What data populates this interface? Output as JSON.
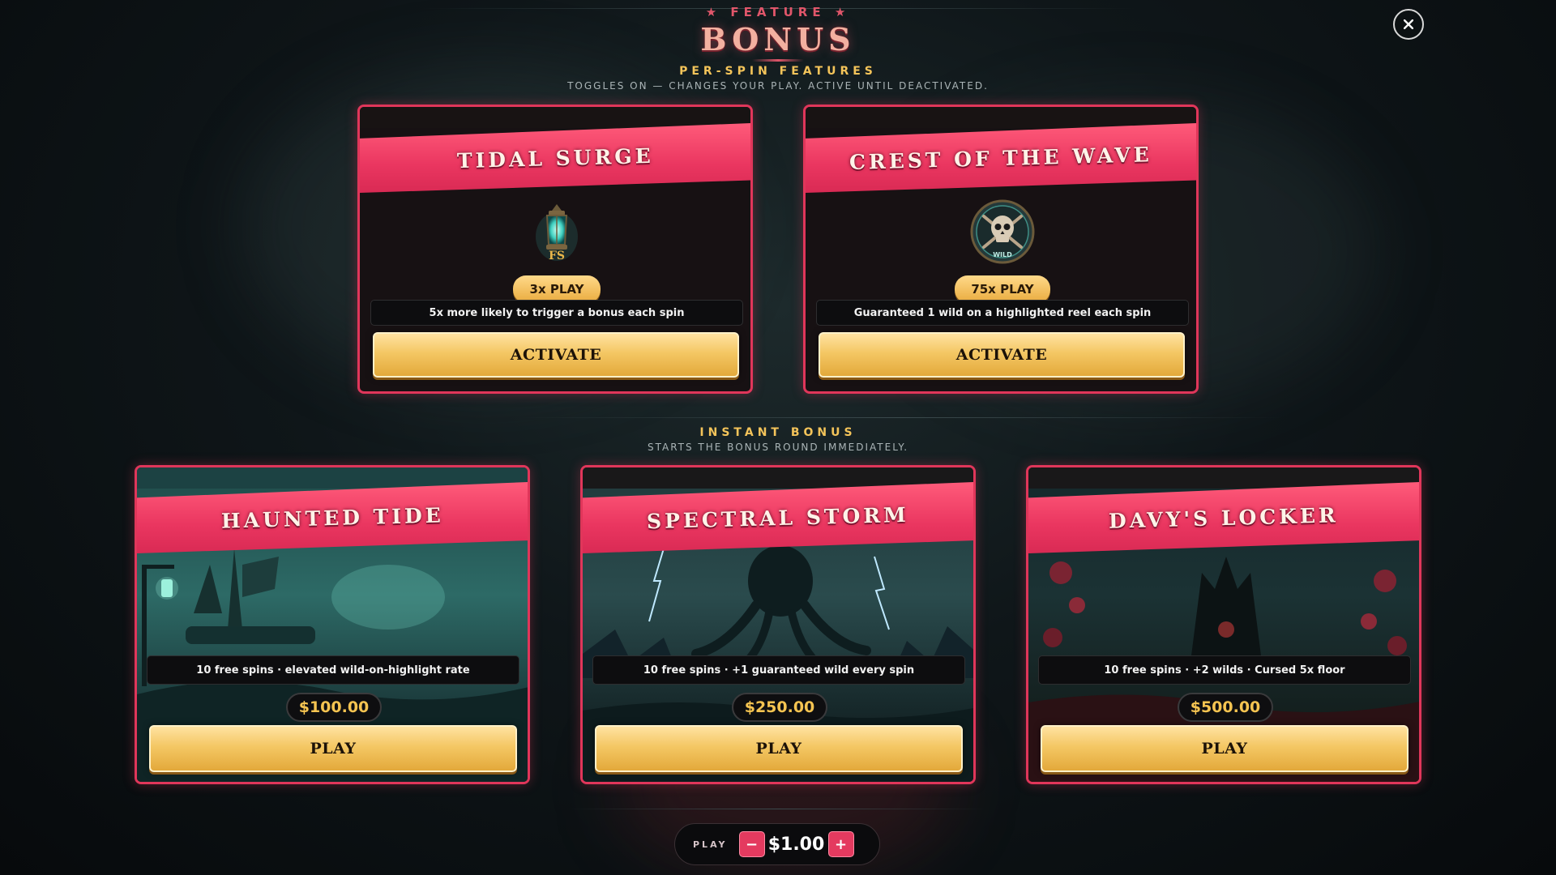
{
  "header": {
    "kicker": "FEATURE",
    "title": "BONUS"
  },
  "close_symbol": "close-icon",
  "per_spin": {
    "title": "PER-SPIN FEATURES",
    "subtitle": "TOGGLES ON — CHANGES YOUR PLAY. ACTIVE UNTIL DEACTIVATED.",
    "cards": [
      {
        "name": "TIDAL SURGE",
        "icon": "lantern-fs-icon",
        "cost": "3x PLAY",
        "description": "5x more likely to trigger a bonus each spin",
        "button": "ACTIVATE"
      },
      {
        "name": "CREST OF THE WAVE",
        "icon": "skull-wild-icon",
        "cost": "75x PLAY",
        "description": "Guaranteed 1 wild on a highlighted reel each spin",
        "button": "ACTIVATE"
      }
    ]
  },
  "instant": {
    "title": "INSTANT BONUS",
    "subtitle": "STARTS THE BONUS ROUND IMMEDIATELY.",
    "cards": [
      {
        "name": "HAUNTED TIDE",
        "scene": "ghost-ship-scene",
        "description": "10 free spins · elevated wild-on-highlight rate",
        "price": "$100.00",
        "button": "PLAY"
      },
      {
        "name": "SPECTRAL STORM",
        "scene": "kraken-storm-scene",
        "description": "10 free spins · +1 guaranteed wild every spin",
        "price": "$250.00",
        "button": "PLAY"
      },
      {
        "name": "DAVY'S LOCKER",
        "scene": "coral-throne-scene",
        "description": "10 free spins · +2 wilds · Cursed 5x floor",
        "price": "$500.00",
        "button": "PLAY"
      }
    ]
  },
  "stake": {
    "label": "PLAY",
    "value": "$1.00",
    "minus": "−",
    "plus": "+"
  },
  "colors": {
    "accent_pink": "#e0365a",
    "gold": "#f4c764",
    "section_gold": "#f4c45a",
    "background": "#0f1619"
  }
}
